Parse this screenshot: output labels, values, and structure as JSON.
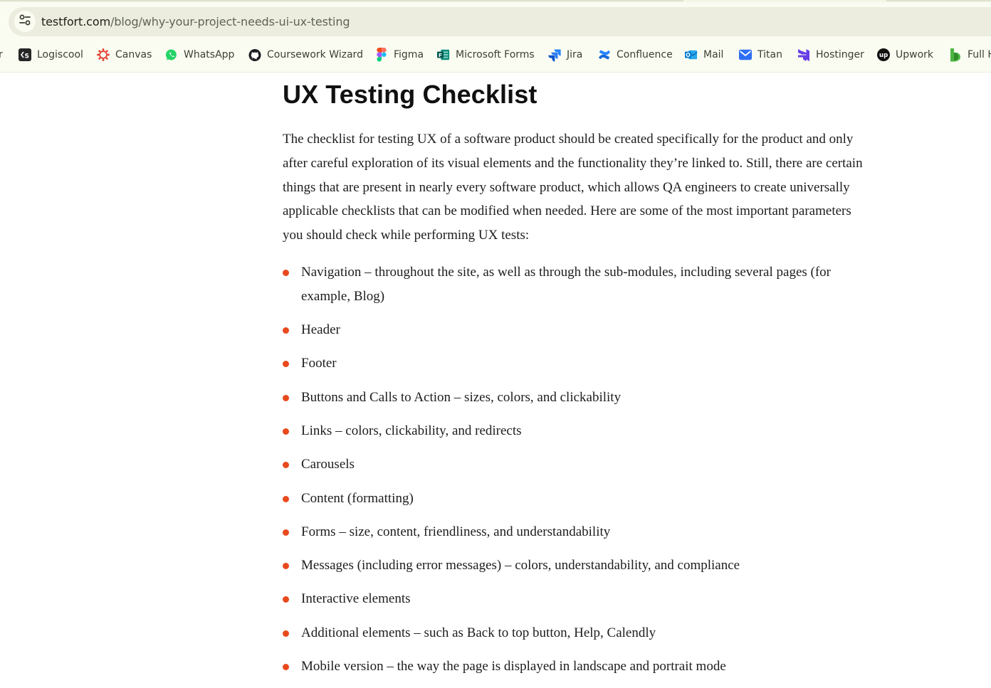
{
  "browser": {
    "url_host": "testfort.com",
    "url_path": "/blog/why-your-project-needs-ui-ux-testing",
    "bookmark_cut_left": "r",
    "bookmarks": [
      {
        "label": "Logiscool",
        "icon": "logiscool-icon"
      },
      {
        "label": "Canvas",
        "icon": "canvas-icon"
      },
      {
        "label": "WhatsApp",
        "icon": "whatsapp-icon"
      },
      {
        "label": "Coursework Wizard",
        "icon": "github-icon"
      },
      {
        "label": "Figma",
        "icon": "figma-icon"
      },
      {
        "label": "Microsoft Forms",
        "icon": "microsoft-forms-icon"
      },
      {
        "label": "Jira",
        "icon": "jira-icon"
      },
      {
        "label": "Confluence",
        "icon": "confluence-icon"
      },
      {
        "label": "Mail",
        "icon": "outlook-mail-icon"
      },
      {
        "label": "Titan",
        "icon": "titan-mail-icon"
      },
      {
        "label": "Hostinger",
        "icon": "hostinger-icon"
      },
      {
        "label": "Upwork",
        "icon": "upwork-icon"
      },
      {
        "label": "Full H",
        "icon": "bookmark-green-icon"
      }
    ]
  },
  "article": {
    "heading": "UX Testing Checklist",
    "intro": "The checklist for testing UX of a software product should be created specifically for the product and only after careful exploration of its visual elements and the functionality they’re linked to. Still, there are certain things that are present in nearly every software product, which allows QA engineers to create universally applicable checklists that can be modified when needed. Here are some of the most important parameters you should check while performing UX tests:",
    "bullet_color": "#e8491d",
    "items": [
      "Navigation – throughout the site, as well as through the sub-modules, including several pages (for example, Blog)",
      "Header",
      "Footer",
      "Buttons and Calls to Action – sizes, colors, and clickability",
      "Links – colors, clickability, and redirects",
      "Carousels",
      "Content (formatting)",
      "Forms – size, content, friendliness, and understandability",
      "Messages (including error messages) – colors, understandability, and compliance",
      "Interactive elements",
      "Additional elements – such as Back to top button, Help, Calendly",
      "Mobile version – the way the page is displayed in landscape and portrait mode"
    ]
  }
}
